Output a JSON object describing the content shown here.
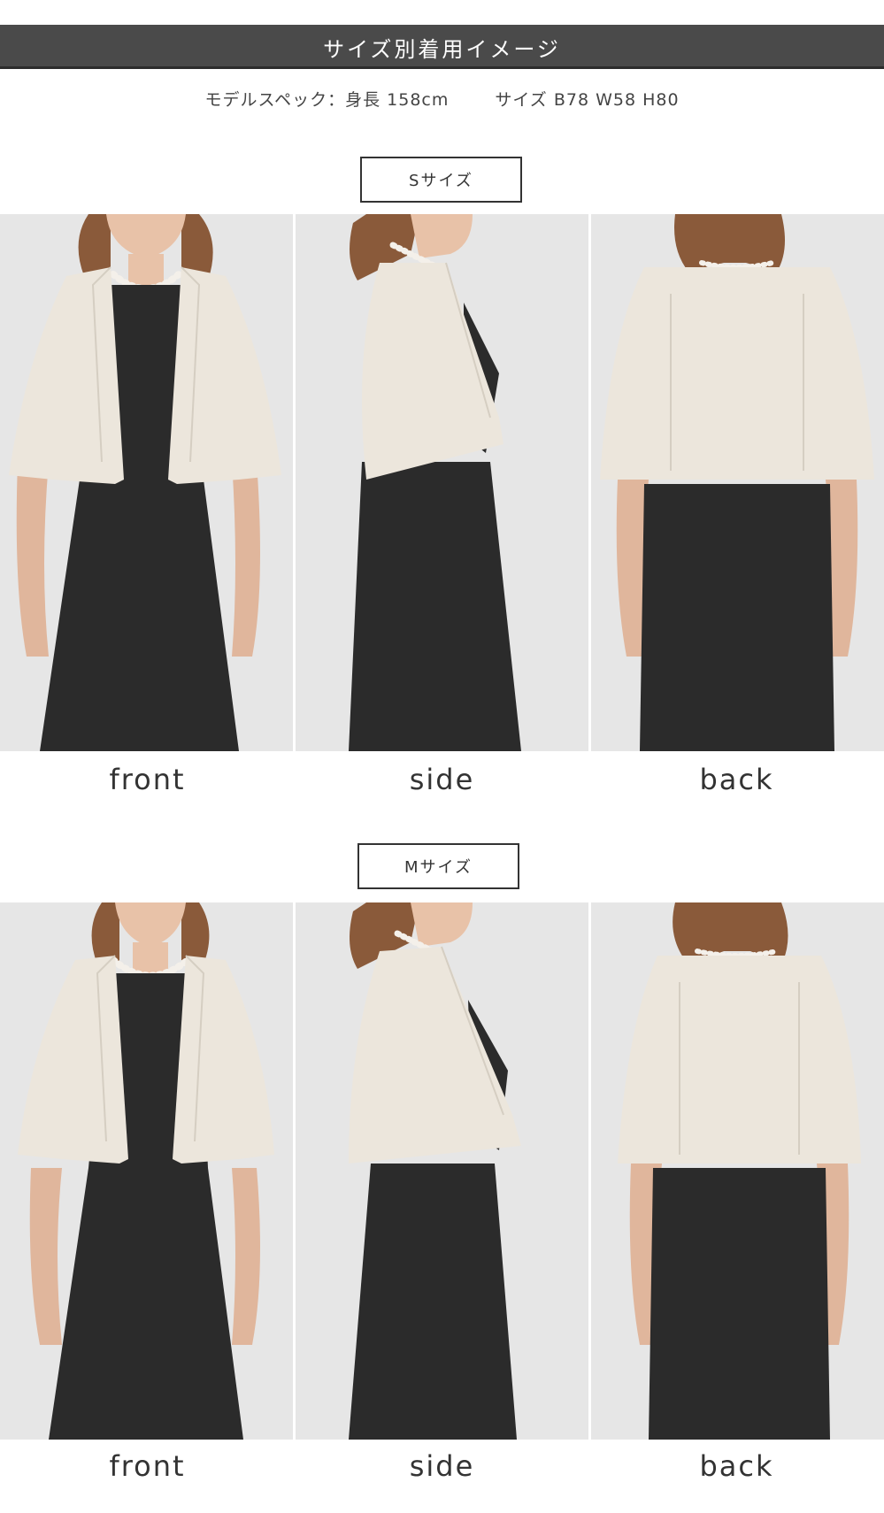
{
  "header": {
    "title": "サイズ別着用イメージ"
  },
  "spec": {
    "model": "モデルスペック：身長 158cm",
    "size": "サイズ B78 W58 H80"
  },
  "sections": [
    {
      "label": "Sサイズ",
      "captions": [
        "front",
        "side",
        "back"
      ]
    },
    {
      "label": "Mサイズ",
      "captions": [
        "front",
        "side",
        "back"
      ]
    }
  ],
  "colors": {
    "header_bg": "#4a4a4a",
    "bolero": "#ece6dc",
    "dress": "#2b2b2b",
    "hair": "#8a5a3a",
    "skin": "#e8c2a8",
    "photo_bg": "#e6e6e6"
  }
}
